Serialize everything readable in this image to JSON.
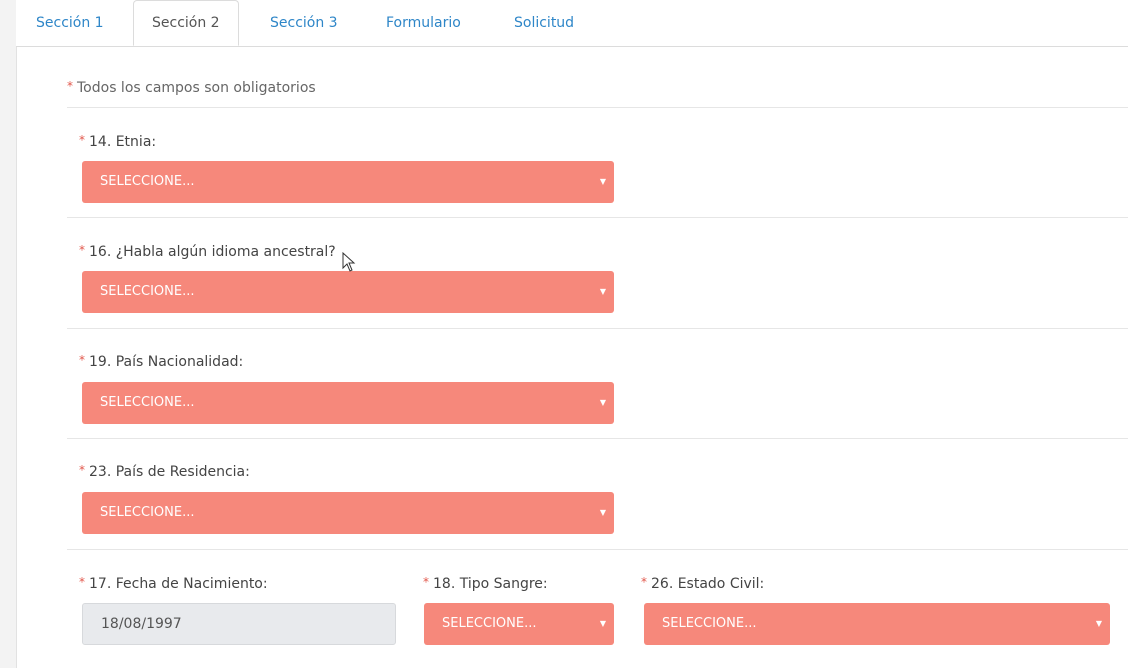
{
  "tabs": [
    {
      "label": "Sección 1",
      "active": false
    },
    {
      "label": "Sección 2",
      "active": true
    },
    {
      "label": "Sección 3",
      "active": false
    },
    {
      "label": "Formulario",
      "active": false
    },
    {
      "label": "Solicitud",
      "active": false
    }
  ],
  "form": {
    "required_star": "*",
    "required_note": "Todos los campos son obligatorios",
    "etnia": {
      "label": "14. Etnia:",
      "value": "SELECCIONE..."
    },
    "idioma": {
      "label": "16. ¿Habla algún idioma ancestral?",
      "value": "SELECCIONE..."
    },
    "nacionalidad": {
      "label": "19. País Nacionalidad:",
      "value": "SELECCIONE..."
    },
    "residencia": {
      "label": "23. País de Residencia:",
      "value": "SELECCIONE..."
    },
    "fecha_nacimiento": {
      "label": "17. Fecha de Nacimiento:",
      "value": "18/08/1997"
    },
    "tipo_sangre": {
      "label": "18. Tipo Sangre:",
      "value": "SELECCIONE..."
    },
    "estado_civil": {
      "label": "26. Estado Civil:",
      "value": "SELECCIONE..."
    },
    "caret_glyph": "▼"
  },
  "colors": {
    "select_bg": "#f6887b",
    "tab_link": "#2e86c8",
    "required_star": "#e2574c"
  }
}
